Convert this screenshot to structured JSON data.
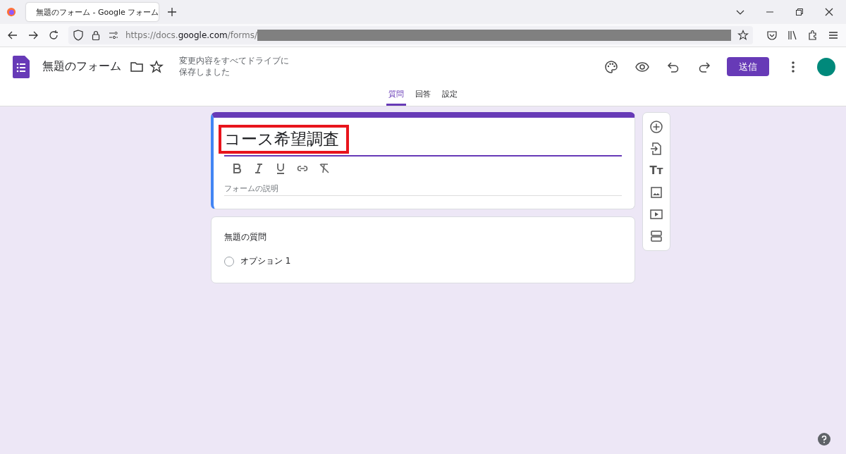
{
  "browser": {
    "tab_title": "無題のフォーム - Google フォーム",
    "url_prefix": "https://docs.",
    "url_domain": "google.com",
    "url_path": "/forms/"
  },
  "header": {
    "title": "無題のフォーム",
    "save_status": [
      "変更内容をすべてドライブに",
      "保存しました"
    ],
    "send_button": "送信"
  },
  "tabs": [
    {
      "label": "質問",
      "selected": true
    },
    {
      "label": "回答",
      "selected": false
    },
    {
      "label": "設定",
      "selected": false
    }
  ],
  "form": {
    "title": "コース希望調査",
    "title_highlighted": true,
    "description_placeholder": "フォームの説明"
  },
  "question": {
    "title": "無題の質問",
    "options": [
      {
        "label": "オプション 1",
        "selected": false
      }
    ]
  },
  "side_toolbar": {
    "text_tool_glyph": "Tт"
  }
}
